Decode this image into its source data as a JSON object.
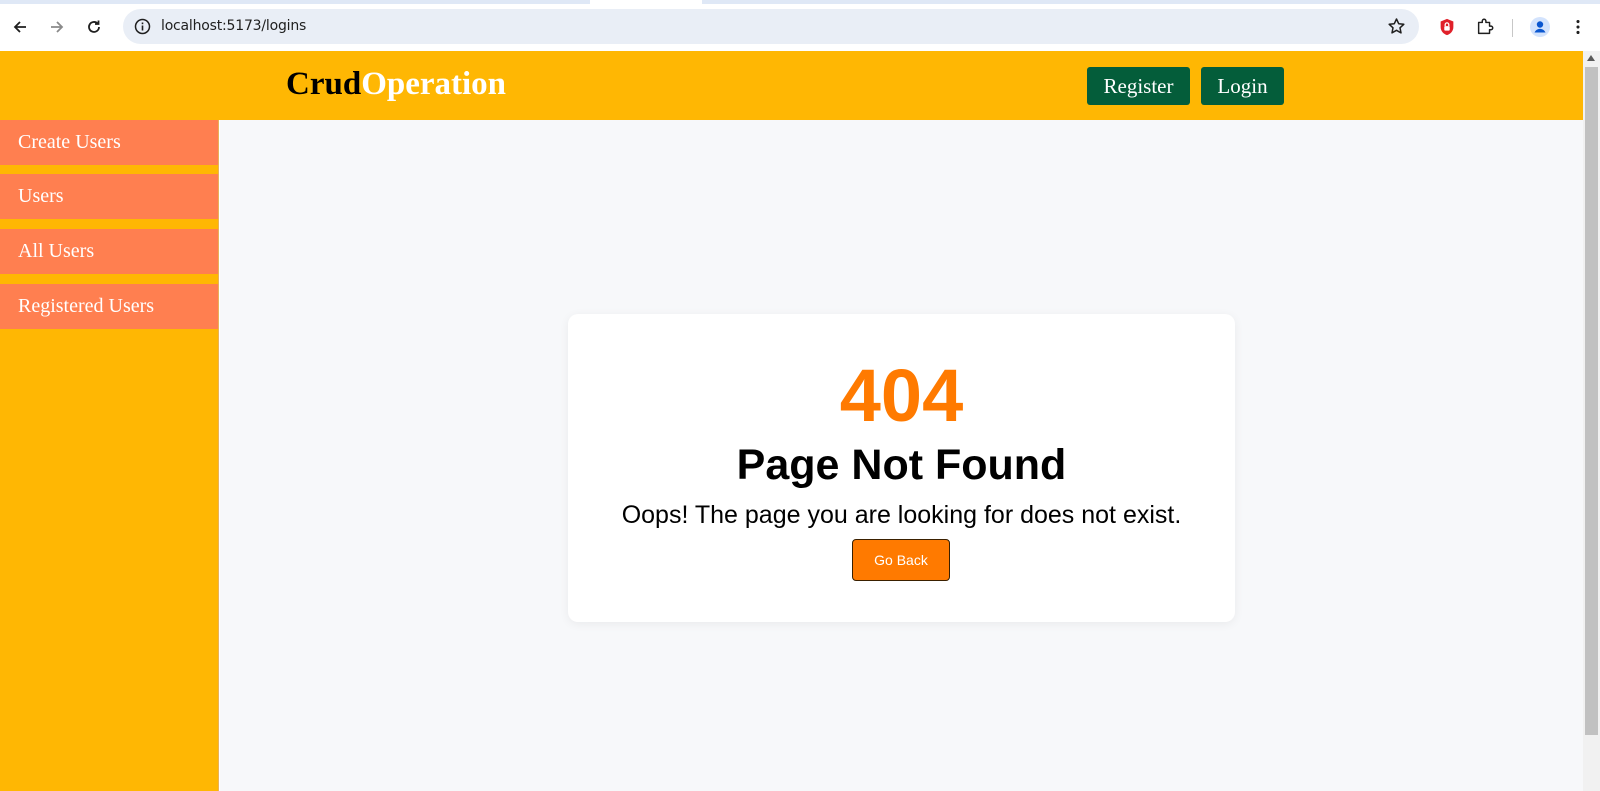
{
  "browser": {
    "url": "localhost:5173/logins",
    "icons": {
      "back": "arrow-left-icon",
      "forward": "arrow-right-icon",
      "reload": "reload-icon",
      "site_info": "info-icon",
      "bookmark": "star-icon",
      "shield_extension": "shield-icon",
      "extensions": "puzzle-icon",
      "profile": "avatar-icon",
      "menu": "kebab-menu-icon"
    }
  },
  "navbar": {
    "brand_part1": "Crud",
    "brand_part2": "Operation",
    "register_label": "Register",
    "login_label": "Login"
  },
  "sidebar": {
    "items": [
      {
        "label": "Create Users"
      },
      {
        "label": "Users"
      },
      {
        "label": "All Users"
      },
      {
        "label": "Registered Users"
      }
    ]
  },
  "error_card": {
    "code": "404",
    "title": "Page Not Found",
    "message": "Oops! The page you are looking for does not exist.",
    "button_label": "Go Back"
  },
  "colors": {
    "navbar_bg": "#ffb703",
    "sidebar_item_bg": "#ff7f50",
    "nav_button_bg": "#045d3a",
    "error_accent": "#ff7a00",
    "content_bg": "#f7f8fa"
  }
}
